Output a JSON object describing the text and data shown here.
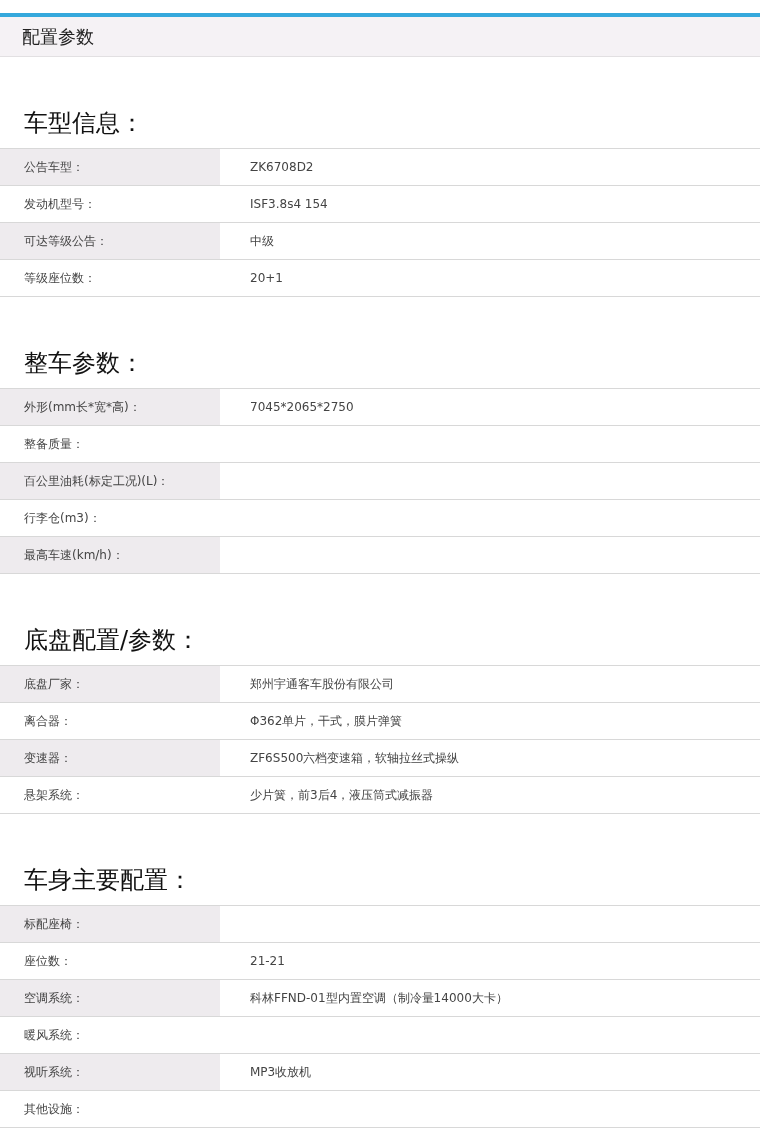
{
  "header": {
    "title": "配置参数"
  },
  "sections": [
    {
      "heading": "车型信息：",
      "rows": [
        {
          "label": "公告车型：",
          "value": "ZK6708D2"
        },
        {
          "label": "发动机型号：",
          "value": "ISF3.8s4 154"
        },
        {
          "label": "可达等级公告：",
          "value": "中级"
        },
        {
          "label": "等级座位数：",
          "value": "20+1"
        }
      ]
    },
    {
      "heading": "整车参数：",
      "rows": [
        {
          "label": "外形(mm长*宽*高)：",
          "value": "7045*2065*2750"
        },
        {
          "label": "整备质量："
        },
        {
          "label": "百公里油耗(标定工况)(L)："
        },
        {
          "label": "行李仓(m3)："
        },
        {
          "label": "最高车速(km/h)："
        }
      ]
    },
    {
      "heading": "底盘配置/参数：",
      "rows": [
        {
          "label": "底盘厂家：",
          "value": "郑州宇通客车股份有限公司"
        },
        {
          "label": "离合器：",
          "value": "Φ362单片，干式，膜片弹簧"
        },
        {
          "label": "变速器：",
          "value": "ZF6S500六档变速箱，软轴拉丝式操纵"
        },
        {
          "label": "悬架系统：",
          "value": "少片簧，前3后4，液压筒式减振器"
        }
      ]
    },
    {
      "heading": "车身主要配置：",
      "rows": [
        {
          "label": "标配座椅："
        },
        {
          "label": "座位数：",
          "value": "21-21"
        },
        {
          "label": "空调系统：",
          "value": "科林FFND-01型内置空调（制冷量14000大卡）"
        },
        {
          "label": "暖风系统："
        },
        {
          "label": "视听系统：",
          "value": "MP3收放机"
        },
        {
          "label": "其他设施："
        }
      ]
    }
  ]
}
